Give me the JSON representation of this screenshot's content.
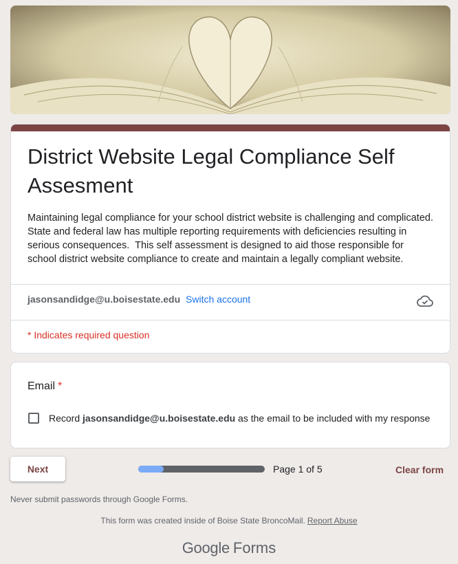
{
  "header": {
    "image_alt": "open book pages forming a heart"
  },
  "form": {
    "title": "District Website Legal Compliance Self Assesment",
    "description": "Maintaining legal compliance for your school district website is challenging and complicated.  State and federal law has multiple reporting requirements with deficiencies resulting in serious consequences.  This self assessment is designed to aid those responsible for school district website compliance to create and maintain a legally compliant website.",
    "account_email": "jasonsandidge@u.boisestate.edu",
    "switch_account": "Switch account",
    "required_note": "* Indicates required question",
    "theme_color": "#7c4444"
  },
  "question": {
    "label": "Email",
    "required_mark": "*",
    "checkbox_prefix": "Record ",
    "checkbox_email": "jasonsandidge@u.boisestate.edu",
    "checkbox_suffix": " as the email to be included with my response",
    "checked": false
  },
  "nav": {
    "next_label": "Next",
    "progress_percent": 20,
    "page_indicator": "Page 1 of 5",
    "clear_label": "Clear form"
  },
  "footer": {
    "password_warning": "Never submit passwords through Google Forms.",
    "created_text": "This form was created inside of Boise State BroncoMail.",
    "report_abuse": "Report Abuse",
    "logo_google": "Google",
    "logo_forms": "Forms"
  },
  "icons": {
    "cloud": "cloud-saved-icon"
  }
}
